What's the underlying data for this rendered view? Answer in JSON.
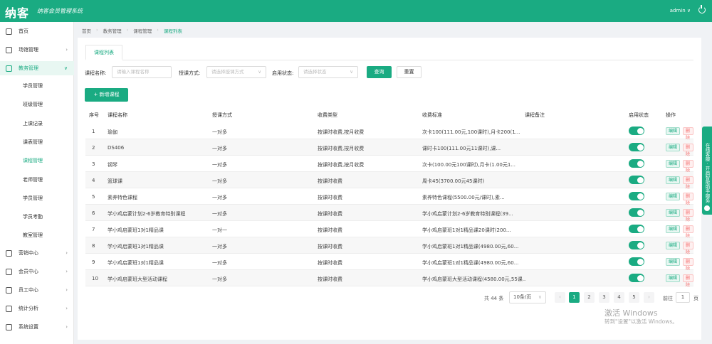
{
  "topbar": {
    "logo": "纳客",
    "slogan": "纳客会员管理系统",
    "user": "admin ∨"
  },
  "sidebar": {
    "items": [
      {
        "label": "首页",
        "arrow": ""
      },
      {
        "label": "场馆管理",
        "arrow": "›"
      },
      {
        "label": "教务管理",
        "arrow": "∨"
      },
      {
        "label": "营销中心",
        "arrow": "›"
      },
      {
        "label": "会员中心",
        "arrow": "›"
      },
      {
        "label": "员工中心",
        "arrow": "›"
      },
      {
        "label": "统计分析",
        "arrow": "›"
      },
      {
        "label": "系统设置",
        "arrow": "›"
      }
    ],
    "sub_items": [
      "学员管理",
      "班级管理",
      "上课记录",
      "课表管理",
      "课程管理",
      "老师管理",
      "学员管理",
      "学员考勤",
      "教室管理"
    ]
  },
  "breadcrumb": [
    "首页",
    "教务管理",
    "课程管理",
    "课程列表"
  ],
  "tab": "课程列表",
  "filters": {
    "name_label": "课程名称:",
    "name_placeholder": "请输入课程名称",
    "method_label": "授课方式:",
    "method_placeholder": "请选择授课方式",
    "status_label": "启用状态:",
    "status_placeholder": "请选择状态",
    "search": "查询",
    "reset": "重置"
  },
  "add_button": "+ 新增课程",
  "table": {
    "headers": [
      "序号",
      "课程名称",
      "授课方式",
      "收费类型",
      "收费标准",
      "课程备注",
      "启用状态",
      "操作"
    ],
    "rows": [
      {
        "no": "1",
        "name": "瑜伽",
        "method": "一对多",
        "fee_type": "按课时收费,按月收费",
        "standard": "次卡100(111.00元,100课时),月卡200(1..."
      },
      {
        "no": "2",
        "name": "DS406",
        "method": "一对多",
        "fee_type": "按课时收费,按月收费",
        "standard": "课时卡100(111.00元11课时),课..."
      },
      {
        "no": "3",
        "name": "钢琴",
        "method": "一对多",
        "fee_type": "按课时收费,按月收费",
        "standard": "次卡(100.00元100课时),月卡(1.00元1..."
      },
      {
        "no": "4",
        "name": "篮球课",
        "method": "一对多",
        "fee_type": "按课时收费",
        "standard": "周卡45(3700.00元45课时)"
      },
      {
        "no": "5",
        "name": "素养特色课程",
        "method": "一对多",
        "fee_type": "按课时收费",
        "standard": "素养特色课程(5500.00元/课时),素..."
      },
      {
        "no": "6",
        "name": "学小鸡启蒙计划2-6岁教育特别课程",
        "method": "一对多",
        "fee_type": "按课时收费",
        "standard": "学小鸡启蒙计划2-6岁教育特别课程(39..."
      },
      {
        "no": "7",
        "name": "学小鸡启蒙班1对1精品课",
        "method": "一对一",
        "fee_type": "按课时收费",
        "standard": "学小鸡启蒙班1对1精品课20课时(200..."
      },
      {
        "no": "8",
        "name": "学小鸡启蒙班1对1精品课",
        "method": "一对多",
        "fee_type": "按课时收费",
        "standard": "学小鸡启蒙班1对1精品课(4980.00元,60..."
      },
      {
        "no": "9",
        "name": "学小鸡启蒙班1对1精品课",
        "method": "一对多",
        "fee_type": "按课时收费",
        "standard": "学小鸡启蒙班1对1精品课(4980.00元,60..."
      },
      {
        "no": "10",
        "name": "学小鸡启蒙班大型活动课程",
        "method": "一对多",
        "fee_type": "按课时收费",
        "standard": "学小鸡启蒙班大型活动课程(4580.00元,55课..."
      }
    ],
    "edit_label": "编辑",
    "delete_label": "删除"
  },
  "pagination": {
    "total": "共 44 条",
    "page_size": "10条/页",
    "prev": "‹",
    "next": "›",
    "pages": [
      "1",
      "2",
      "3",
      "4",
      "5"
    ],
    "goto_label": "前往",
    "goto_value": "1",
    "page_suffix": "页"
  },
  "float_tab": "在线客服 · 开启智能助手服务",
  "watermark": {
    "line1": "激活 Windows",
    "line2": "转到\"设置\"以激活 Windows。"
  },
  "colors": {
    "primary": "#1aab82",
    "danger": "#f56c6c"
  }
}
